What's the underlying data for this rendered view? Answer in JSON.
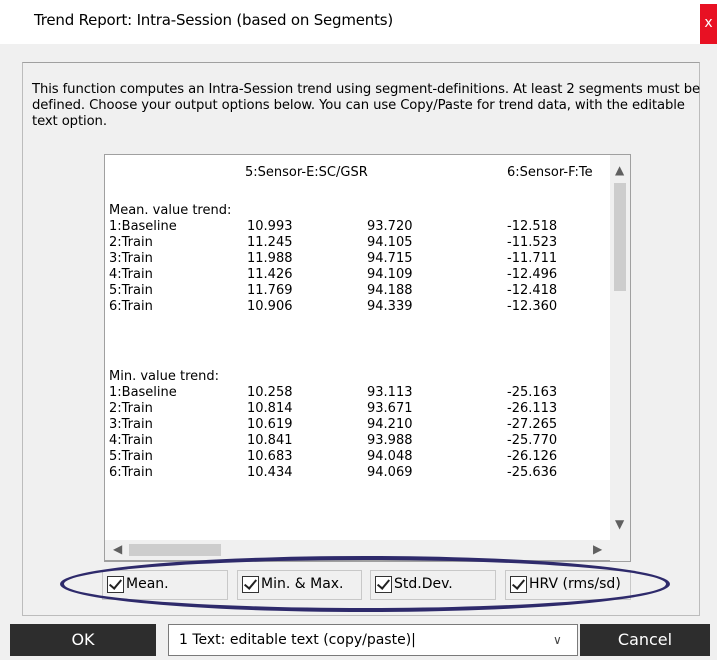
{
  "window": {
    "title": "Trend Report: Intra-Session (based on Segments)",
    "close_glyph": "x"
  },
  "description": "This function computes an Intra-Session trend using segment-definitions. At least 2 segments must be defined. Choose your output options below. You can use Copy/Paste for trend data, with the editable text option.",
  "table": {
    "columns": [
      "5:Sensor-E:SC/GSR",
      "6:Sensor-F:Te"
    ],
    "sections": [
      {
        "title": "Mean.  value trend:",
        "rows": [
          {
            "label": "1:Baseline",
            "values": [
              "10.993",
              "93.720",
              "-12.518"
            ]
          },
          {
            "label": "2:Train",
            "values": [
              "11.245",
              "94.105",
              "-11.523"
            ]
          },
          {
            "label": "3:Train",
            "values": [
              "11.988",
              "94.715",
              "-11.711"
            ]
          },
          {
            "label": "4:Train",
            "values": [
              "11.426",
              "94.109",
              "-12.496"
            ]
          },
          {
            "label": "5:Train",
            "values": [
              "11.769",
              "94.188",
              "-12.418"
            ]
          },
          {
            "label": "6:Train",
            "values": [
              "10.906",
              "94.339",
              "-12.360"
            ]
          }
        ]
      },
      {
        "title": "Min.  value trend:",
        "rows": [
          {
            "label": "1:Baseline",
            "values": [
              "10.258",
              "93.113",
              "-25.163"
            ]
          },
          {
            "label": "2:Train",
            "values": [
              "10.814",
              "93.671",
              "-26.113"
            ]
          },
          {
            "label": "3:Train",
            "values": [
              "10.619",
              "94.210",
              "-27.265"
            ]
          },
          {
            "label": "4:Train",
            "values": [
              "10.841",
              "93.988",
              "-25.770"
            ]
          },
          {
            "label": "5:Train",
            "values": [
              "10.683",
              "94.048",
              "-26.126"
            ]
          },
          {
            "label": "6:Train",
            "values": [
              "10.434",
              "94.069",
              "-25.636"
            ]
          }
        ]
      }
    ]
  },
  "options": [
    {
      "label": "Mean.",
      "checked": true
    },
    {
      "label": "Min. & Max.",
      "checked": true
    },
    {
      "label": "Std.Dev.",
      "checked": true
    },
    {
      "label": "HRV (rms/sd)",
      "checked": true
    }
  ],
  "footer": {
    "ok_label": "OK",
    "cancel_label": "Cancel",
    "output_select_value": "1 Text:  editable text (copy/paste)|"
  },
  "colors": {
    "close_bg": "#e81123",
    "highlight_ellipse": "#2e2a6b",
    "button_bg": "#2d2d2d"
  }
}
